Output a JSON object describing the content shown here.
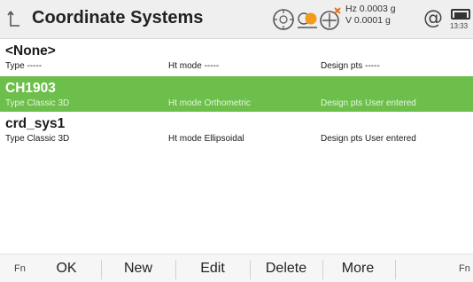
{
  "header": {
    "title": "Coordinate Systems",
    "hz_readout": "Hz 0.0003 g",
    "v_readout": "V  0.0001 g",
    "time": "13:33",
    "icons": [
      "back-icon",
      "level-bubble-icon",
      "target-prism-icon",
      "compensator-off-icon",
      "at-sign-icon",
      "battery-icon"
    ]
  },
  "list": {
    "rows": [
      {
        "name": "<None>",
        "type": "Type  -----",
        "ht_mode": "Ht mode  -----",
        "design_pts": "Design pts  -----",
        "selected": false
      },
      {
        "name": "CH1903",
        "type": "Type  Classic 3D",
        "ht_mode": "Ht mode  Orthometric",
        "design_pts": "Design pts  User entered",
        "selected": true
      },
      {
        "name": "crd_sys1",
        "type": "Type  Classic 3D",
        "ht_mode": "Ht mode  Ellipsoidal",
        "design_pts": "Design pts  User entered",
        "selected": false
      }
    ]
  },
  "softkeys": {
    "fn_left": "Fn",
    "ok": "OK",
    "new": "New",
    "edit": "Edit",
    "delete": "Delete",
    "more": "More",
    "fn_right": "Fn"
  },
  "colors": {
    "selected_row": "#6cbf4a",
    "titlebar": "#efefef",
    "target_accent": "#f29a1a"
  }
}
